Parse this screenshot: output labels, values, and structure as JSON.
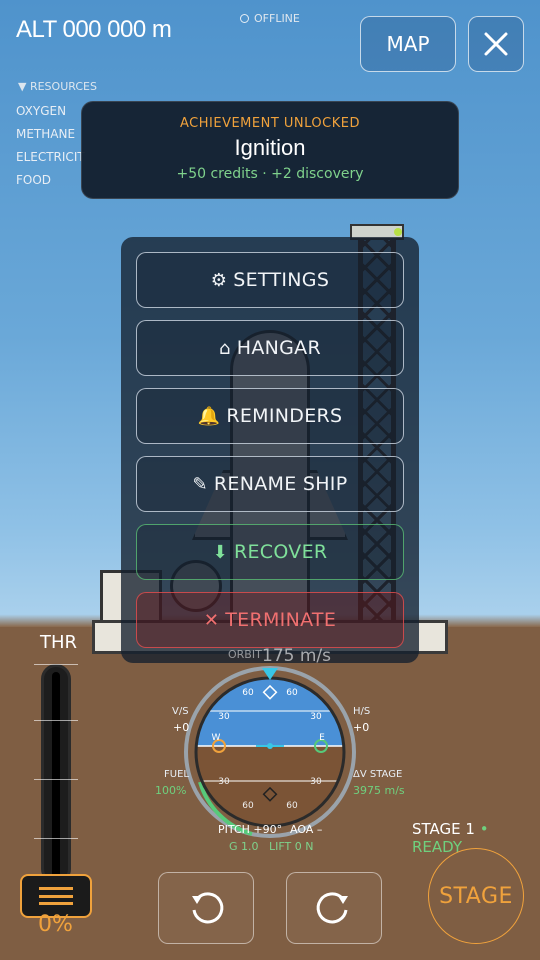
{
  "hud": {
    "altitude": "ALT 000 000 m",
    "connection": "OFFLINE",
    "map_label": "MAP"
  },
  "resources": {
    "header": "▼ RESOURCES",
    "items": [
      {
        "label": "OXYGEN"
      },
      {
        "label": "METHANE"
      },
      {
        "label": "ELECTRICIT"
      },
      {
        "label": "FOOD"
      }
    ]
  },
  "achievement": {
    "kicker": "ACHIEVEMENT UNLOCKED",
    "title": "Ignition",
    "reward": "+50 credits · +2 discovery"
  },
  "menu": {
    "items": [
      {
        "icon": "⚙",
        "label": "SETTINGS"
      },
      {
        "icon": "⌂",
        "label": "HANGAR"
      },
      {
        "icon": "🔔",
        "label": "REMINDERS"
      },
      {
        "icon": "✎",
        "label": "RENAME SHIP"
      },
      {
        "icon": "⬇",
        "label": "RECOVER"
      },
      {
        "icon": "✕",
        "label": "TERMINATE"
      }
    ]
  },
  "throttle": {
    "label": "THR",
    "value": "0%",
    "level": 0
  },
  "flight": {
    "orbit_label": "ORBIT",
    "orbit_value": "175 m/s",
    "vs_label": "V/S",
    "vs_value": "+0",
    "hs_label": "H/S",
    "hs_value": "+0",
    "fuel_label": "FUEL",
    "fuel_value": "100%",
    "dv_label": "ΔV STAGE",
    "dv_value": "3975 m/s",
    "pitch": "PITCH +90°",
    "aoa": "AOA –",
    "g": "G 1.0",
    "lift": "LIFT 0 N",
    "ndl_ticks": {
      "top": [
        "60",
        "60"
      ],
      "upper": [
        "30",
        "30"
      ],
      "lower": [
        "30",
        "30"
      ],
      "bottom": [
        "60",
        "60"
      ],
      "west": "W",
      "east": "E"
    }
  },
  "stage": {
    "status_prefix": "STAGE 1",
    "status_ready": "• READY",
    "button": "STAGE"
  },
  "colors": {
    "accent": "#f0a23c",
    "ok": "#6fd07e",
    "danger": "#f07070"
  }
}
